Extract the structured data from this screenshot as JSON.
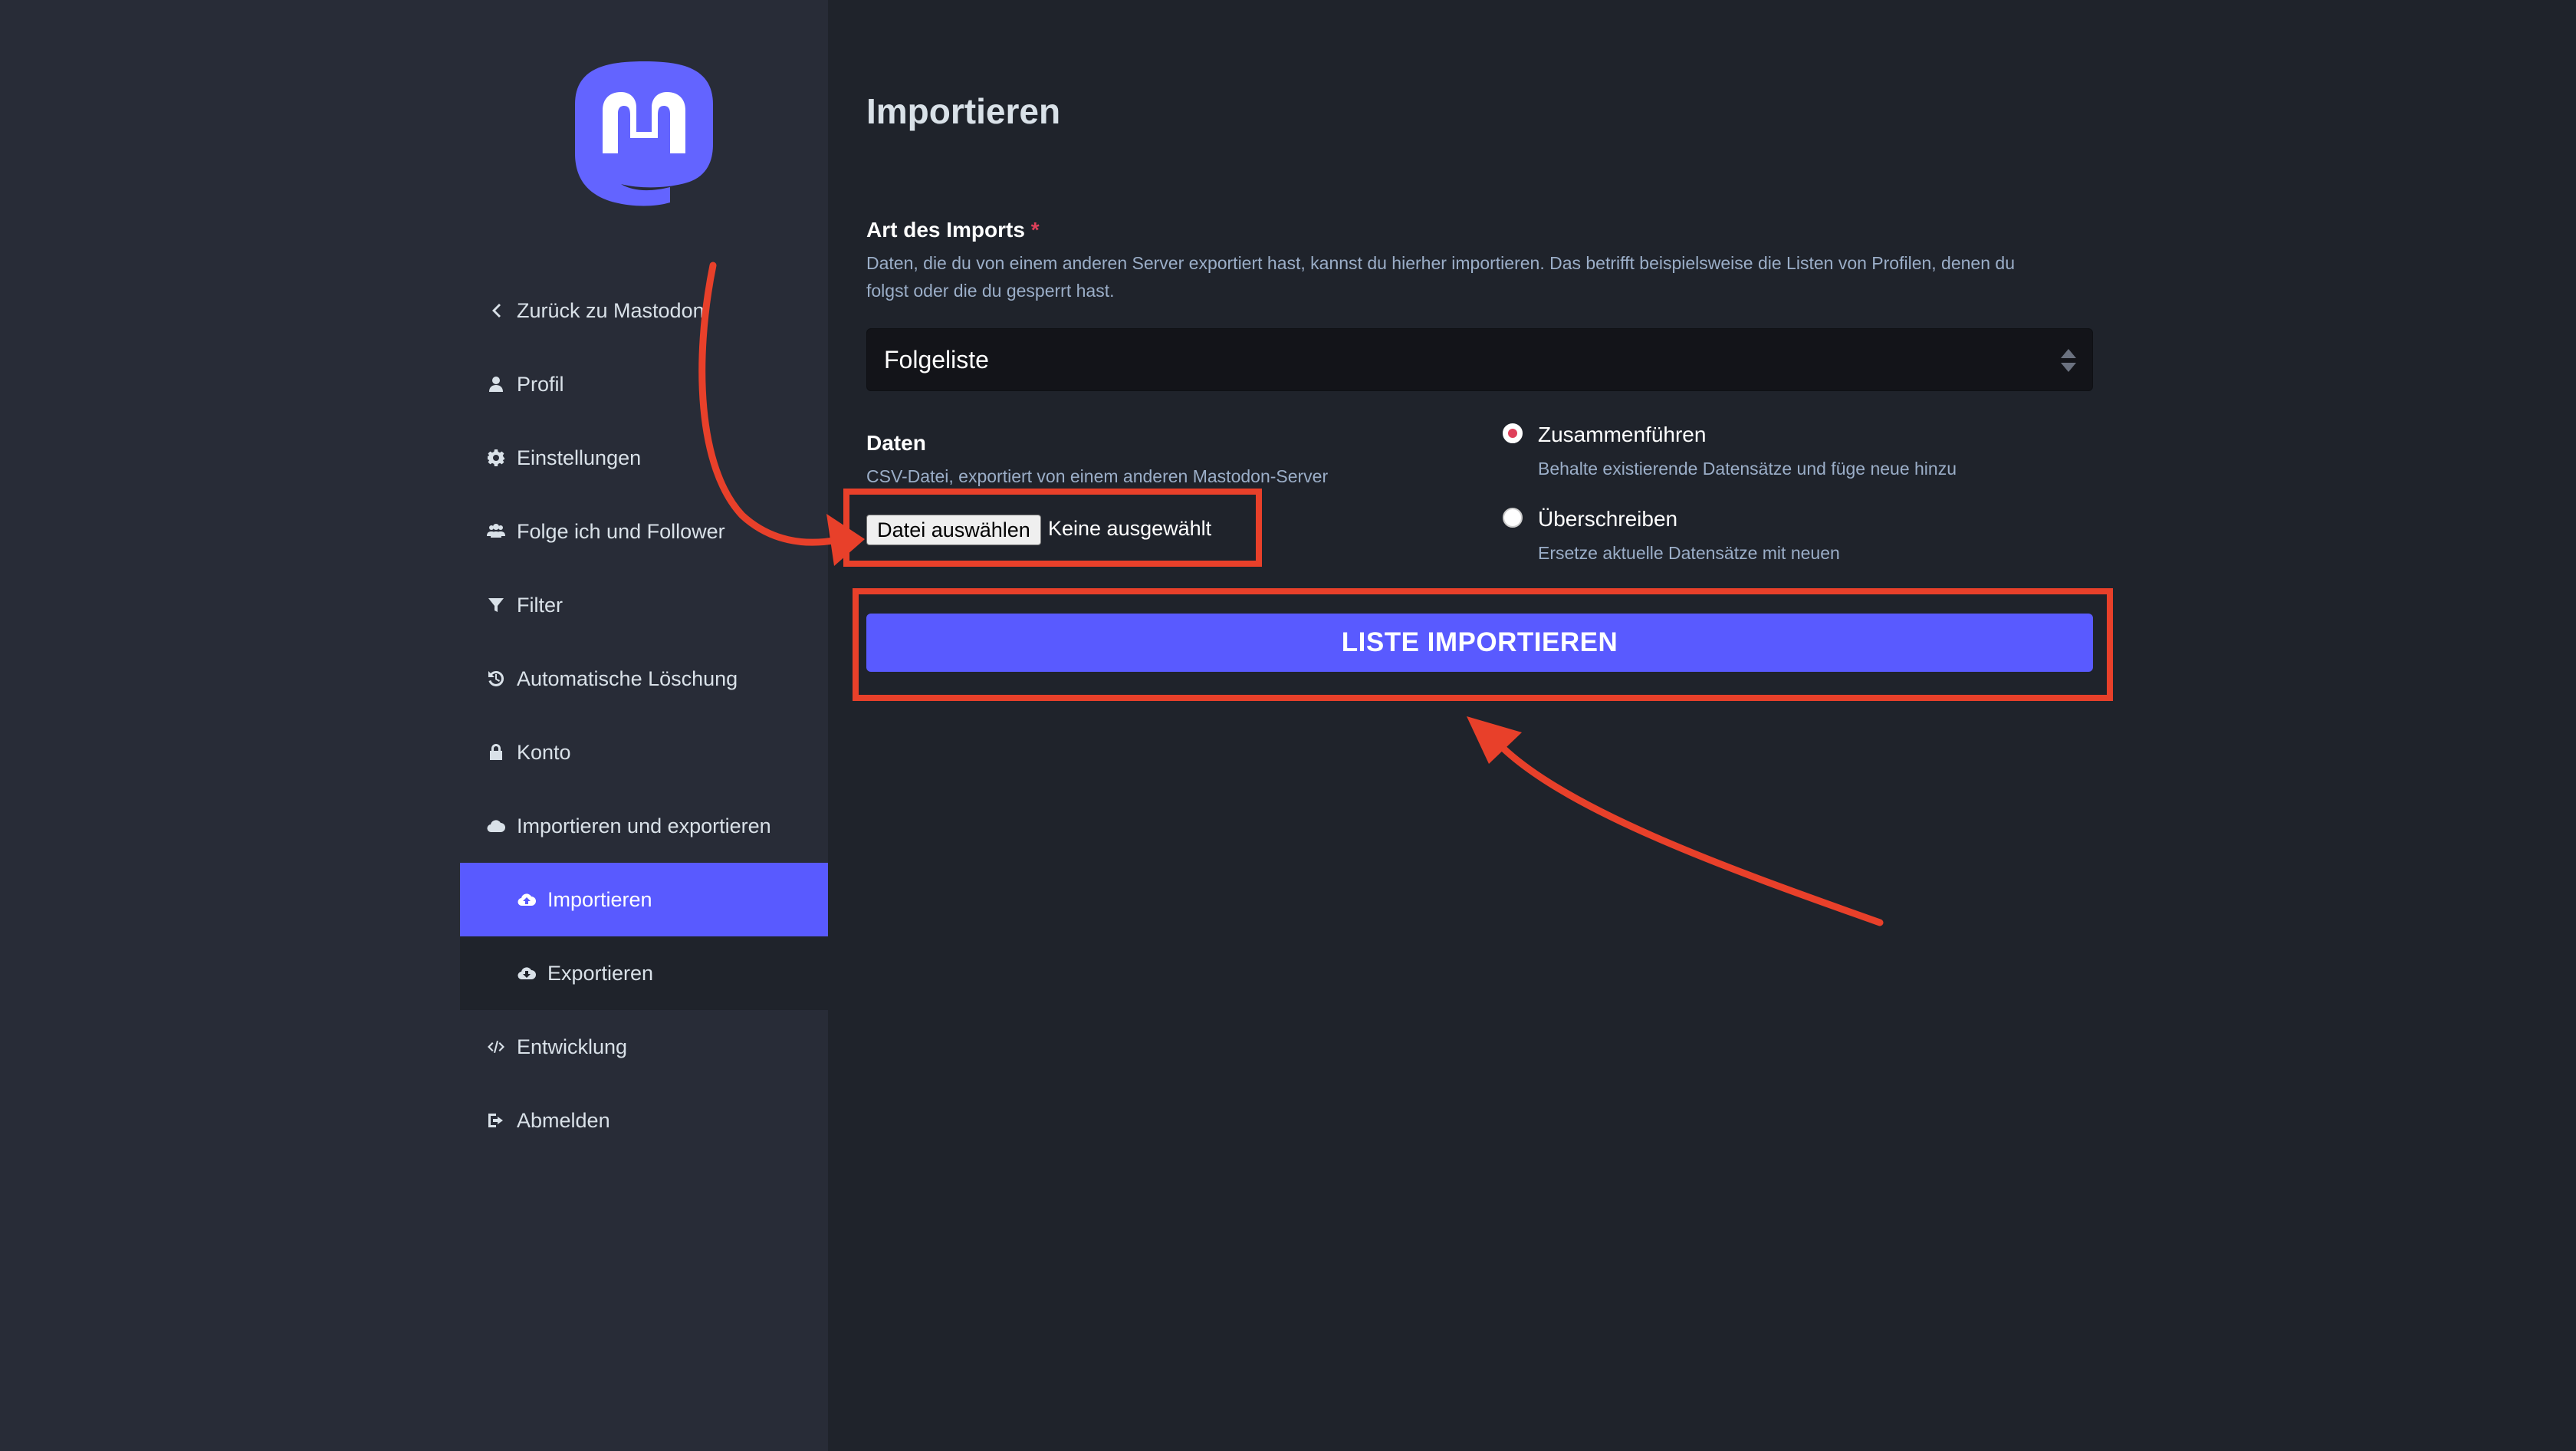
{
  "app": {
    "name": "Mastodon",
    "colors": {
      "accent": "#595aff",
      "sidebar": "#282c37",
      "main": "#1f232b",
      "annotation": "#e8402a"
    }
  },
  "sidebar": {
    "items": [
      {
        "label": "Zurück zu Mastodon",
        "icon": "chevron-left-icon"
      },
      {
        "label": "Profil",
        "icon": "user-icon"
      },
      {
        "label": "Einstellungen",
        "icon": "gear-icon"
      },
      {
        "label": "Folge ich und Follower",
        "icon": "users-icon"
      },
      {
        "label": "Filter",
        "icon": "filter-icon"
      },
      {
        "label": "Automatische Löschung",
        "icon": "history-icon"
      },
      {
        "label": "Konto",
        "icon": "lock-icon"
      },
      {
        "label": "Importieren und exportieren",
        "icon": "cloud-icon"
      },
      {
        "label": "Importieren",
        "icon": "cloud-upload-icon",
        "active": true
      },
      {
        "label": "Exportieren",
        "icon": "cloud-download-icon"
      },
      {
        "label": "Entwicklung",
        "icon": "code-icon"
      },
      {
        "label": "Abmelden",
        "icon": "sign-out-icon"
      }
    ]
  },
  "main": {
    "title": "Importieren",
    "import_type": {
      "label": "Art des Imports",
      "required_marker": "*",
      "hint_line1": "Daten, die du von einem anderen Server exportiert hast, kannst du hierher importieren. Das betrifft beispielsweise die Listen von Profilen, denen du",
      "hint_line2": "folgst oder die du gesperrt hast.",
      "selected": "Folgeliste"
    },
    "data": {
      "label": "Daten",
      "hint": "CSV-Datei, exportiert von einem anderen Mastodon-Server",
      "file_button": "Datei auswählen",
      "file_status": "Keine ausgewählt"
    },
    "mode": {
      "options": [
        {
          "label": "Zusammenführen",
          "hint": "Behalte existierende Datensätze und füge neue hinzu",
          "selected": true
        },
        {
          "label": "Überschreiben",
          "hint": "Ersetze aktuelle Datensätze mit neuen",
          "selected": false
        }
      ]
    },
    "submit_label": "LISTE IMPORTIEREN"
  }
}
